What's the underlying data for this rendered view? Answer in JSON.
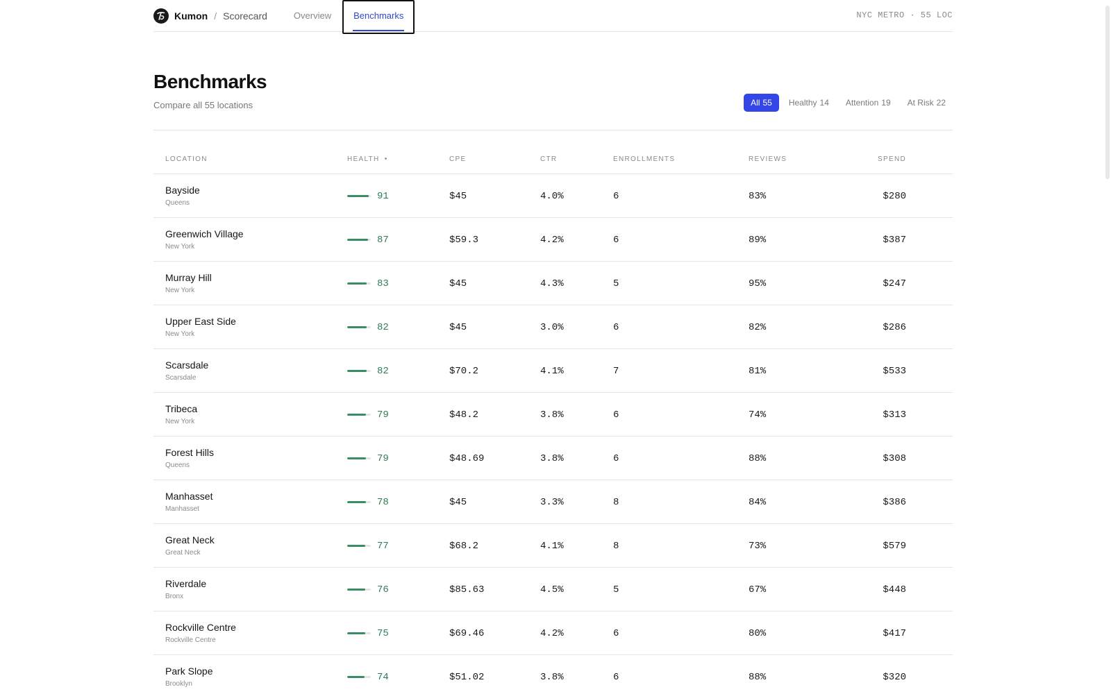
{
  "header": {
    "brand": "Kumon",
    "separator": "/",
    "crumb": "Scorecard",
    "tabs": [
      {
        "label": "Overview",
        "active": false
      },
      {
        "label": "Benchmarks",
        "active": true
      }
    ],
    "region": "NYC METRO · 55 LOC"
  },
  "page": {
    "title": "Benchmarks",
    "subtitle": "Compare all 55 locations"
  },
  "filters": [
    {
      "label": "All",
      "count": "55",
      "active": true
    },
    {
      "label": "Healthy",
      "count": "14",
      "active": false
    },
    {
      "label": "Attention",
      "count": "19",
      "active": false
    },
    {
      "label": "At Risk",
      "count": "22",
      "active": false
    }
  ],
  "table": {
    "columns": {
      "location": "LOCATION",
      "health": "HEALTH",
      "cpe": "CPE",
      "ctr": "CTR",
      "enrollments": "ENROLLMENTS",
      "reviews": "REVIEWS",
      "spend": "SPEND"
    },
    "rows": [
      {
        "name": "Bayside",
        "area": "Queens",
        "health": "91",
        "cpe": "$45",
        "ctr": "4.0%",
        "enrollments": "6",
        "reviews": "83%",
        "spend": "$280"
      },
      {
        "name": "Greenwich Village",
        "area": "New York",
        "health": "87",
        "cpe": "$59.3",
        "ctr": "4.2%",
        "enrollments": "6",
        "reviews": "89%",
        "spend": "$387"
      },
      {
        "name": "Murray Hill",
        "area": "New York",
        "health": "83",
        "cpe": "$45",
        "ctr": "4.3%",
        "enrollments": "5",
        "reviews": "95%",
        "spend": "$247"
      },
      {
        "name": "Upper East Side",
        "area": "New York",
        "health": "82",
        "cpe": "$45",
        "ctr": "3.0%",
        "enrollments": "6",
        "reviews": "82%",
        "spend": "$286"
      },
      {
        "name": "Scarsdale",
        "area": "Scarsdale",
        "health": "82",
        "cpe": "$70.2",
        "ctr": "4.1%",
        "enrollments": "7",
        "reviews": "81%",
        "spend": "$533"
      },
      {
        "name": "Tribeca",
        "area": "New York",
        "health": "79",
        "cpe": "$48.2",
        "ctr": "3.8%",
        "enrollments": "6",
        "reviews": "74%",
        "spend": "$313"
      },
      {
        "name": "Forest Hills",
        "area": "Queens",
        "health": "79",
        "cpe": "$48.69",
        "ctr": "3.8%",
        "enrollments": "6",
        "reviews": "88%",
        "spend": "$308"
      },
      {
        "name": "Manhasset",
        "area": "Manhasset",
        "health": "78",
        "cpe": "$45",
        "ctr": "3.3%",
        "enrollments": "8",
        "reviews": "84%",
        "spend": "$386"
      },
      {
        "name": "Great Neck",
        "area": "Great Neck",
        "health": "77",
        "cpe": "$68.2",
        "ctr": "4.1%",
        "enrollments": "8",
        "reviews": "73%",
        "spend": "$579"
      },
      {
        "name": "Riverdale",
        "area": "Bronx",
        "health": "76",
        "cpe": "$85.63",
        "ctr": "4.5%",
        "enrollments": "5",
        "reviews": "67%",
        "spend": "$448"
      },
      {
        "name": "Rockville Centre",
        "area": "Rockville Centre",
        "health": "75",
        "cpe": "$69.46",
        "ctr": "4.2%",
        "enrollments": "6",
        "reviews": "80%",
        "spend": "$417"
      },
      {
        "name": "Park Slope",
        "area": "Brooklyn",
        "health": "74",
        "cpe": "$51.02",
        "ctr": "3.8%",
        "enrollments": "6",
        "reviews": "88%",
        "spend": "$320"
      }
    ]
  },
  "colors": {
    "accent": "#3347e6",
    "health_good": "#2f7d56"
  },
  "icons": {
    "logo": "kumon-logo-icon",
    "sort": "sort-indicator-icon"
  }
}
